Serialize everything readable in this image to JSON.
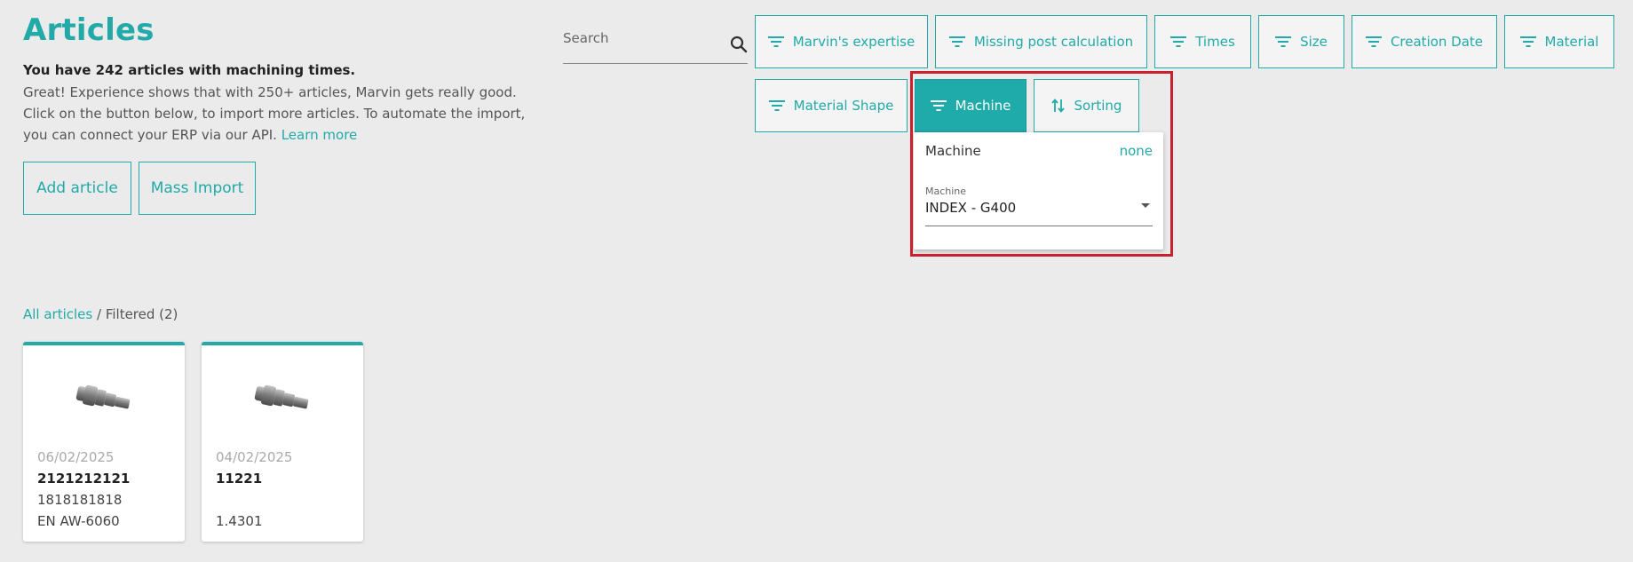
{
  "header": {
    "title": "Articles",
    "subtitle": "You have 242 articles with machining times.",
    "intro_text": "Great! Experience shows that with 250+ articles, Marvin gets really good. Click on the button below, to import more articles. To automate the import, you can connect your ERP via our API.",
    "learn_more": "Learn more"
  },
  "actions": {
    "add_article": "Add article",
    "mass_import": "Mass Import"
  },
  "search": {
    "placeholder": "Search",
    "value": ""
  },
  "filters": [
    {
      "label": "Marvin's expertise",
      "icon": "filter-icon"
    },
    {
      "label": "Missing post calculation",
      "icon": "filter-icon"
    },
    {
      "label": "Times",
      "icon": "filter-icon"
    },
    {
      "label": "Size",
      "icon": "filter-icon"
    },
    {
      "label": "Creation Date",
      "icon": "filter-icon"
    },
    {
      "label": "Material",
      "icon": "filter-icon"
    },
    {
      "label": "Material Shape",
      "icon": "filter-icon"
    },
    {
      "label": "Machine",
      "icon": "filter-icon",
      "active": true
    },
    {
      "label": "Sorting",
      "icon": "sort-icon"
    }
  ],
  "dropdown": {
    "title": "Machine",
    "clear": "none",
    "select_label": "Machine",
    "select_value": "INDEX - G400"
  },
  "breadcrumb": {
    "all": "All articles",
    "separator": " / ",
    "current": "Filtered (2)"
  },
  "articles": [
    {
      "date": "06/02/2025",
      "number": "2121212121",
      "line2": "1818181818",
      "line3": "EN AW-6060"
    },
    {
      "date": "04/02/2025",
      "number": "11221",
      "line2": "",
      "line3": "1.4301"
    }
  ],
  "colors": {
    "accent": "#21aaa8",
    "active_button": "#1eaba9",
    "highlight": "#c8202f",
    "background": "#ebebeb"
  }
}
